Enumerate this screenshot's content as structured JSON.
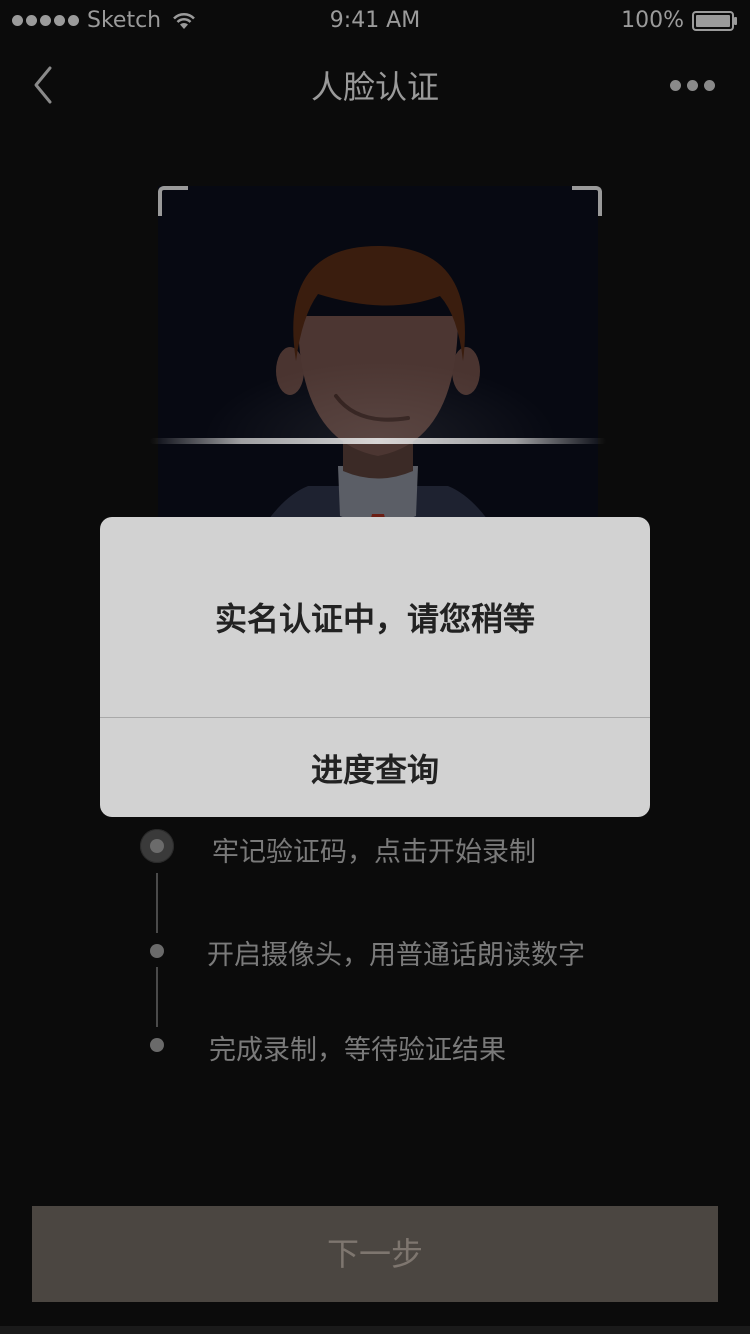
{
  "status_bar": {
    "carrier": "Sketch",
    "time": "9:41 AM",
    "battery": "100%"
  },
  "nav": {
    "title": "人脸认证"
  },
  "steps": [
    {
      "text": "牢记验证码，点击开始录制"
    },
    {
      "text": "开启摄像头，用普通话朗读数字"
    },
    {
      "text": "完成录制，等待验证结果"
    }
  ],
  "next_button": {
    "label": "下一步"
  },
  "dialog": {
    "message": "实名认证中，请您稍等",
    "action_label": "进度查询"
  },
  "icons": {
    "back": "chevron-left-icon",
    "more": "more-dots-icon",
    "wifi": "wifi-icon",
    "battery": "battery-icon",
    "avatar": "face-avatar-icon"
  },
  "colors": {
    "background": "#0b0b0b",
    "dialog_bg": "#d2d2d2",
    "button_bg": "#4b4641"
  }
}
